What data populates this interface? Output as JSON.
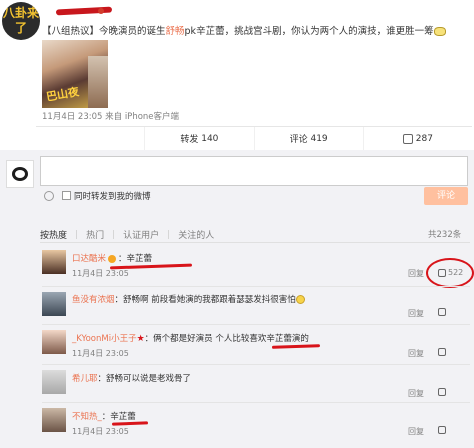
{
  "post": {
    "avatar_text": "八卦来了",
    "text_prefix": "【八组热议】今晚演员的诞生",
    "text_hl1": "舒畅",
    "text_mid": "pk辛芷蕾，挑战宫斗剧，你认为两个人的演技，谁更胜一筹",
    "image_label": "巴山夜",
    "meta": "11月4日 23:05 来自 iPhone客户端"
  },
  "actions": [
    {
      "label": "",
      "count": ""
    },
    {
      "label": "转发",
      "count": "140"
    },
    {
      "label": "评论",
      "count": "419"
    },
    {
      "label": "",
      "count": "287"
    }
  ],
  "compose": {
    "repost_label": "同时转发到我的微博",
    "submit_label": "评论"
  },
  "filter": {
    "tabs": [
      "按热度",
      "热门",
      "认证用户",
      "关注的人"
    ],
    "total": "共232条"
  },
  "comments": [
    {
      "name": "口达酷米",
      "text": "：辛芷蕾",
      "time": "11月4日 23:05",
      "reply": "回复",
      "likes": "522"
    },
    {
      "name": "鱼没有浓烟",
      "text": "：舒畅啊 前段看她演的我都跟着瑟瑟发抖很害怕",
      "time": "",
      "reply": "回复",
      "likes": ""
    },
    {
      "name": "_KYoonMi小王子",
      "text": "：俩个都是好演员 个人比较喜欢辛芷蕾演的",
      "time": "11月4日 23:05",
      "reply": "回复",
      "likes": ""
    },
    {
      "name": "希儿耶",
      "text": "：舒畅可以说是老戏骨了",
      "time": "",
      "reply": "回复",
      "likes": ""
    },
    {
      "name": "不知热_",
      "text": "：辛芷蕾",
      "time": "11月4日 23:05",
      "reply": "回复",
      "likes": ""
    }
  ]
}
